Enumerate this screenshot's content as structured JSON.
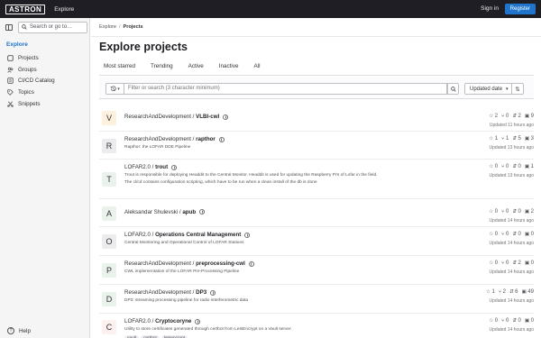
{
  "topbar": {
    "logo": "ASTRON",
    "explore": "Explore",
    "signin": "Sign in",
    "register": "Register"
  },
  "sidebar": {
    "search_placeholder": "Search or go to…",
    "heading": "Explore",
    "items": [
      {
        "label": "Projects",
        "icon": "project-icon"
      },
      {
        "label": "Groups",
        "icon": "group-icon"
      },
      {
        "label": "CI/CD Catalog",
        "icon": "catalog-icon"
      },
      {
        "label": "Topics",
        "icon": "label-icon"
      },
      {
        "label": "Snippets",
        "icon": "snippet-icon"
      }
    ],
    "help": "Help"
  },
  "breadcrumb": {
    "root": "Explore",
    "current": "Projects"
  },
  "page_title": "Explore projects",
  "tabs": [
    "Most starred",
    "Trending",
    "Active",
    "Inactive",
    "All"
  ],
  "filter": {
    "placeholder": "Filter or search (3 character minimum)",
    "sort_label": "Updated date"
  },
  "colors": {
    "topbar": "#1f1e24",
    "accent": "#1f75cb",
    "sidebar": "#f5f5f6"
  },
  "projects": [
    {
      "avatar": "V",
      "avatar_bg": "#fdf1dd",
      "namespace": "ResearchAndDevelopment",
      "name": "VLBI-cwl",
      "description": "",
      "stars": "2",
      "forks": "0",
      "merge_requests": "2",
      "issues": "9",
      "updated": "Updated 11 hours ago"
    },
    {
      "avatar": "R",
      "avatar_bg": "#ececef",
      "namespace": "ResearchAndDevelopment",
      "name": "rapthor",
      "description": "Rapthor: the LOFAR DDE Pipeline",
      "stars": "1",
      "forks": "1",
      "merge_requests": "5",
      "issues": "3",
      "updated": "Updated 13 hours ago"
    },
    {
      "avatar": "T",
      "avatar_bg": "#e9f3eb",
      "namespace": "LOFAR2.0",
      "name": "trout",
      "description": "Trout is responsible for deploying Headdit to the Central Monitor. Headdit is used for updating the Raspberry Pi's of Lofar in the field.",
      "description2": "The cl/cd contains configuration scripting, which have to be run when a clean install of the db is done",
      "stars": "0",
      "forks": "0",
      "merge_requests": "0",
      "issues": "1",
      "updated": "Updated 13 hours ago"
    },
    {
      "avatar": "A",
      "avatar_bg": "#e9f3eb",
      "namespace": "Aleksandar Shulevski",
      "name": "apub",
      "description": "",
      "stars": "0",
      "forks": "0",
      "merge_requests": "0",
      "issues": "2",
      "updated": "Updated 14 hours ago"
    },
    {
      "avatar": "O",
      "avatar_bg": "#ececef",
      "namespace": "LOFAR2.0",
      "name": "Operations Central Management",
      "description": "Central Monitoring and Operational Control of LOFAR Stations",
      "stars": "0",
      "forks": "0",
      "merge_requests": "0",
      "issues": "0",
      "updated": "Updated 14 hours ago"
    },
    {
      "avatar": "P",
      "avatar_bg": "#e9f3eb",
      "namespace": "ResearchAndDevelopment",
      "name": "preprocessing-cwl",
      "description": "CWL implementation of the LOFAR Pre-Processing Pipeline",
      "stars": "0",
      "forks": "0",
      "merge_requests": "2",
      "issues": "0",
      "updated": "Updated 14 hours ago"
    },
    {
      "avatar": "D",
      "avatar_bg": "#e9f3eb",
      "namespace": "ResearchAndDevelopment",
      "name": "DP3",
      "description": "DP3: streaming processing pipeline for radio interferometric data",
      "stars": "1",
      "forks": "2",
      "merge_requests": "6",
      "issues": "49",
      "updated": "Updated 14 hours ago"
    },
    {
      "avatar": "C",
      "avatar_bg": "#fcf1ef",
      "namespace": "LOFAR2.0",
      "name": "Cryptocoryne",
      "description": "Utility to store certificates generated through certbot from LetsEncrypt on a Vault server.",
      "stars": "0",
      "forks": "0",
      "merge_requests": "0",
      "issues": "0",
      "updated": "Updated 14 hours ago",
      "tags": [
        "vault",
        "certbot",
        "letsencrypt"
      ]
    }
  ]
}
